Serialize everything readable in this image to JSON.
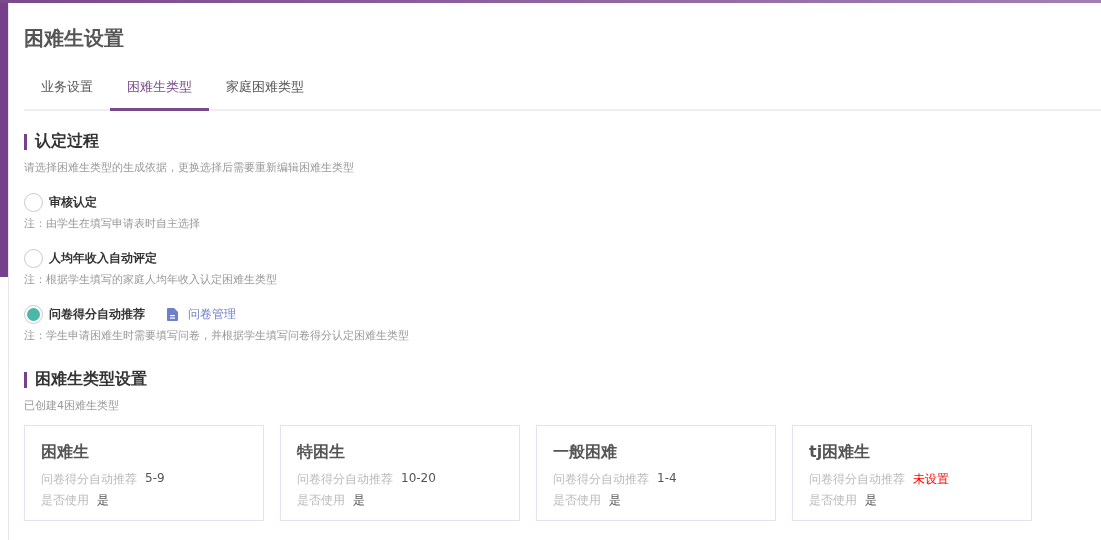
{
  "page_title": "困难生设置",
  "tabs": [
    {
      "label": "业务设置",
      "selected": false
    },
    {
      "label": "困难生类型",
      "selected": true
    },
    {
      "label": "家庭困难类型",
      "selected": false
    }
  ],
  "process_section": {
    "title": "认定过程",
    "description": "请选择困难生类型的生成依据，更换选择后需要重新编辑困难生类型",
    "options": [
      {
        "label": "审核认定",
        "selected": false,
        "note": "注：由学生在填写申请表时自主选择"
      },
      {
        "label": "人均年收入自动评定",
        "selected": false,
        "note": "注：根据学生填写的家庭人均年收入认定困难生类型"
      },
      {
        "label": "问卷得分自动推荐",
        "selected": true,
        "link": "问卷管理",
        "note": "注：学生申请困难生时需要填写问卷，并根据学生填写问卷得分认定困难生类型"
      }
    ]
  },
  "types_section": {
    "title": "困难生类型设置",
    "description": "已创建4困难生类型",
    "cards": [
      {
        "name": "困难生",
        "score_label": "问卷得分自动推荐",
        "score_value": "5-9",
        "score_set": true,
        "use_label": "是否使用",
        "use_value": "是"
      },
      {
        "name": "特困生",
        "score_label": "问卷得分自动推荐",
        "score_value": "10-20",
        "score_set": true,
        "use_label": "是否使用",
        "use_value": "是"
      },
      {
        "name": "一般困难",
        "score_label": "问卷得分自动推荐",
        "score_value": "1-4",
        "score_set": true,
        "use_label": "是否使用",
        "use_value": "是"
      },
      {
        "name": "tj困难生",
        "score_label": "问卷得分自动推荐",
        "score_value": "未设置",
        "score_set": false,
        "use_label": "是否使用",
        "use_value": "是"
      }
    ]
  }
}
